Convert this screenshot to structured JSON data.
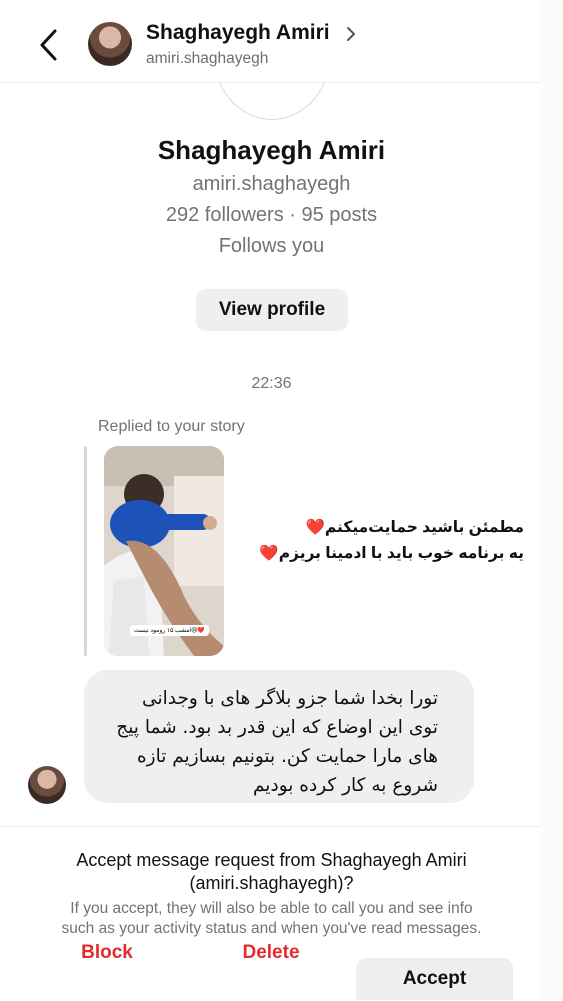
{
  "header": {
    "name": "Shaghayegh Amiri",
    "username": "amiri.shaghayegh",
    "back_icon": "chevron-left-icon",
    "chevron_icon": "chevron-right-icon"
  },
  "profile": {
    "name": "Shaghayegh Amiri",
    "username": "amiri.shaghayegh",
    "stats": "292 followers · 95 posts",
    "follows": "Follows you",
    "view_profile_label": "View profile"
  },
  "thread": {
    "timestamp": "22:36",
    "replied_label": "Replied to your story",
    "story_caption_lines": [
      "مطمئن باشید حمایت‌میکنم❤️",
      "یه برنامه خوب باید با ادمینا بریزم❤️"
    ],
    "story_sticker": "امشب ۱۵ رومود نیست😢❤️",
    "message_lines": [
      "تورا بخدا شما جزو بلاگر های با وجدانی",
      "توی این اوضاع که این قدر بد بود. شما پیج",
      "های مارا حمایت کن. بتونیم بسازیم تازه",
      "شروع به کار کرده بودیم"
    ]
  },
  "request": {
    "title_line1": "Accept message request from Shaghayegh Amiri",
    "title_line2": "(amiri.shaghayegh)?",
    "desc_line1": "If you accept, they will also be able to call you and see info",
    "desc_line2": "such as your activity status and when you've read messages.",
    "block_label": "Block",
    "delete_label": "Delete",
    "accept_label": "Accept"
  },
  "colors": {
    "danger": "#e32b2b",
    "muted_text": "#737373",
    "bubble_bg": "#efefef"
  }
}
